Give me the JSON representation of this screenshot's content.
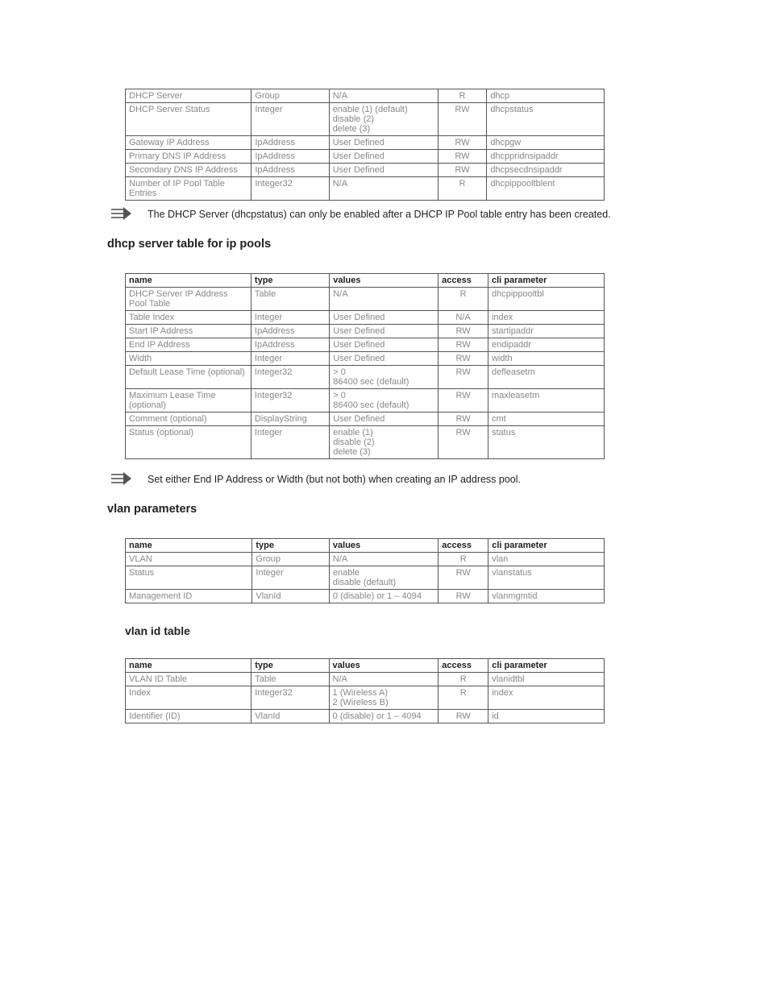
{
  "table1": {
    "rows": [
      {
        "name": "DHCP Server",
        "type": "Group",
        "values": "N/A",
        "access": "R",
        "cli": "dhcp"
      },
      {
        "name": "DHCP Server Status",
        "type": "Integer",
        "values": "enable (1) (default)\ndisable (2)\ndelete (3)",
        "access": "RW",
        "cli": "dhcpstatus"
      },
      {
        "name": "Gateway IP Address",
        "type": "IpAddress",
        "values": "User Defined",
        "access": "RW",
        "cli": "dhcpgw"
      },
      {
        "name": "Primary DNS IP Address",
        "type": "IpAddress",
        "values": "User Defined",
        "access": "RW",
        "cli": "dhcppridnsipaddr"
      },
      {
        "name": "Secondary DNS IP Address",
        "type": "IpAddress",
        "values": "User Defined",
        "access": "RW",
        "cli": "dhcpsecdnsipaddr"
      },
      {
        "name": "Number of IP Pool Table Entries",
        "type": "Integer32",
        "values": "N/A",
        "access": "R",
        "cli": "dhcpippooltblent"
      }
    ]
  },
  "note1": "The DHCP Server (dhcpstatus) can only be enabled after a DHCP IP Pool table entry has been created.",
  "heading1": "dhcp server table for ip pools",
  "colHeaders": {
    "name": "name",
    "type": "type",
    "values": "values",
    "access": "access",
    "cli": "cli parameter"
  },
  "table2": {
    "rows": [
      {
        "name": "DHCP Server IP Address Pool Table",
        "type": "Table",
        "values": "N/A",
        "access": "R",
        "cli": "dhcpippooltbl"
      },
      {
        "name": "Table Index",
        "type": "Integer",
        "values": "User Defined",
        "access": "N/A",
        "cli": "index"
      },
      {
        "name": "Start IP Address",
        "type": "IpAddress",
        "values": "User Defined",
        "access": "RW",
        "cli": "startipaddr"
      },
      {
        "name": "End IP Address",
        "type": "IpAddress",
        "values": "User Defined",
        "access": "RW",
        "cli": "endipaddr"
      },
      {
        "name": "Width",
        "type": "Integer",
        "values": "User Defined",
        "access": "RW",
        "cli": "width"
      },
      {
        "name": "Default Lease Time (optional)",
        "type": "Integer32",
        "values": "> 0\n86400 sec (default)",
        "access": "RW",
        "cli": "defleasetm"
      },
      {
        "name": "Maximum Lease Time (optional)",
        "type": "Integer32",
        "values": "> 0\n86400 sec (default)",
        "access": "RW",
        "cli": "maxleasetm"
      },
      {
        "name": "Comment (optional)",
        "type": "DisplayString",
        "values": "User Defined",
        "access": "RW",
        "cli": "cmt"
      },
      {
        "name": "Status (optional)",
        "type": "Integer",
        "values": "enable (1)\ndisable (2)\ndelete (3)",
        "access": "RW",
        "cli": "status"
      }
    ]
  },
  "note2": "Set either End IP Address or Width (but not both) when creating an IP address pool.",
  "heading2": "vlan parameters",
  "table3": {
    "rows": [
      {
        "name": "VLAN",
        "type": "Group",
        "values": "N/A",
        "access": "R",
        "cli": "vlan"
      },
      {
        "name": "Status",
        "type": "Integer",
        "values": "enable\ndisable (default)",
        "access": "RW",
        "cli": "vlanstatus"
      },
      {
        "name": "Management ID",
        "type": "VlanId",
        "values": "0 (disable) or 1 – 4094",
        "access": "RW",
        "cli": "vlanmgmtid"
      }
    ]
  },
  "heading3": "vlan id table",
  "table4": {
    "rows": [
      {
        "name": "VLAN ID Table",
        "type": "Table",
        "values": "N/A",
        "access": "R",
        "cli": "vlanidtbl"
      },
      {
        "name": "Index",
        "type": "Integer32",
        "values": "1 (Wireless A)\n2 (Wireless B)",
        "access": "R",
        "cli": "index"
      },
      {
        "name": "Identifier (ID)",
        "type": "VlanId",
        "values": "0 (disable) or 1 – 4094",
        "access": "RW",
        "cli": "id"
      }
    ]
  }
}
